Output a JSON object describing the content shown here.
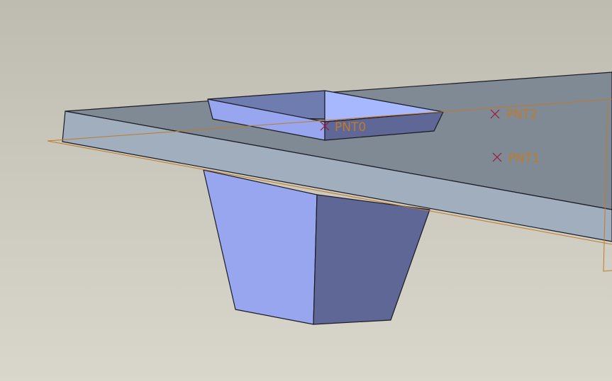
{
  "colors": {
    "datum": "#c07a2a",
    "point_marker": "#a0143c",
    "edge": "#1a1a22",
    "slab_top": "#7f8a95",
    "slab_front": "#a1aebd",
    "face_light": "#97a6ef",
    "face_dark": "#5e6795",
    "face_mid": "#6f7cb0",
    "face_bright": "#a8b8ff"
  },
  "datum_points": [
    {
      "label": "PNT0"
    },
    {
      "label": "PNT2"
    },
    {
      "label": "PNT1"
    }
  ]
}
